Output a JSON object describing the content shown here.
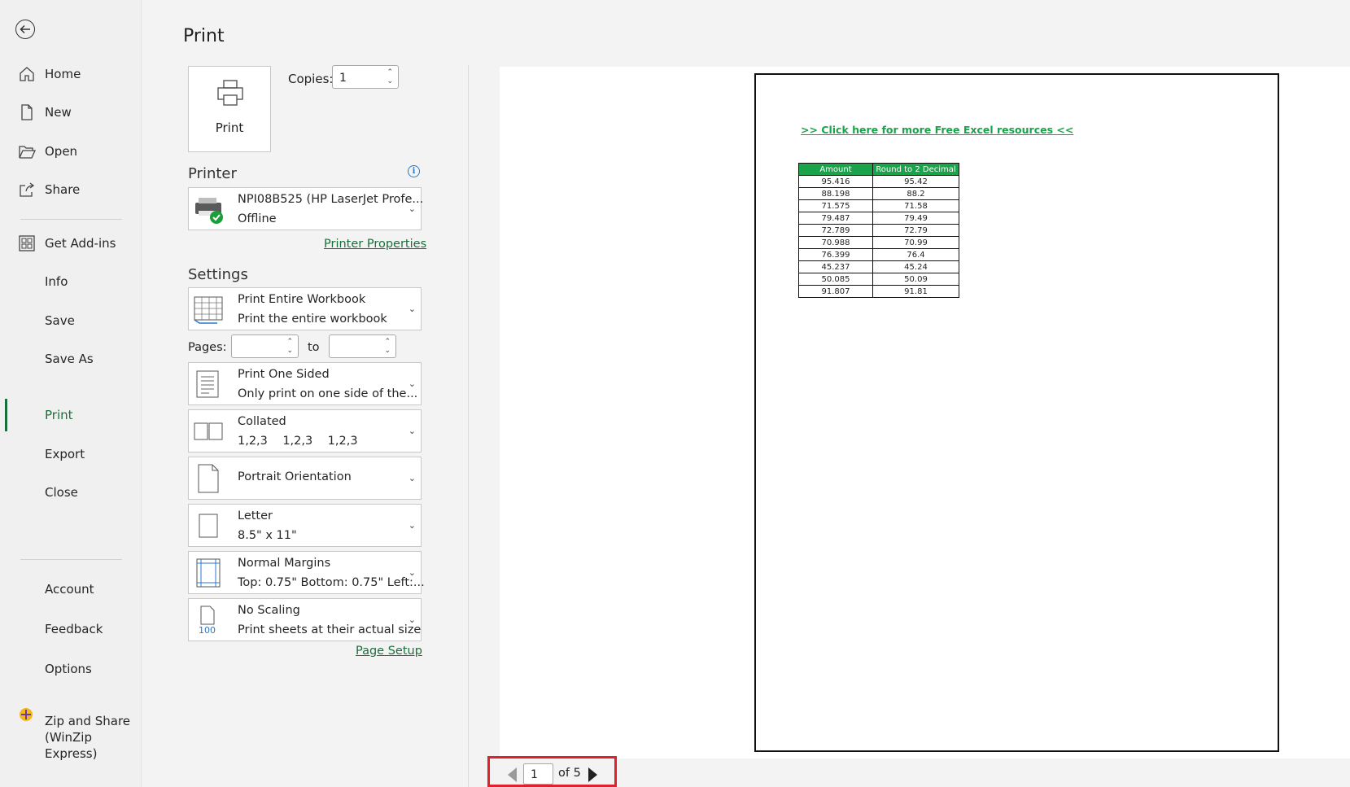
{
  "nav": {
    "items": [
      {
        "label": "Home",
        "icon": "home-icon"
      },
      {
        "label": "New",
        "icon": "new-file-icon"
      },
      {
        "label": "Open",
        "icon": "folder-open-icon"
      },
      {
        "label": "Share",
        "icon": "share-icon"
      },
      {
        "label": "Get Add-ins",
        "icon": "add-ins-grid-icon"
      },
      {
        "label": "Info"
      },
      {
        "label": "Save"
      },
      {
        "label": "Save As"
      },
      {
        "label": "Print",
        "active": true
      },
      {
        "label": "Export"
      },
      {
        "label": "Close"
      },
      {
        "label": "Account"
      },
      {
        "label": "Feedback"
      },
      {
        "label": "Options"
      },
      {
        "label": "Zip and Share (WinZip Express)",
        "icon": "winzip-icon"
      }
    ]
  },
  "print": {
    "title": "Print",
    "print_button": "Print",
    "copies_label": "Copies:",
    "copies_value": "1",
    "printer_heading": "Printer",
    "printer_name": "NPI08B525 (HP LaserJet Profe...",
    "printer_status": "Offline",
    "printer_properties": "Printer Properties",
    "settings_heading": "Settings",
    "what": {
      "line1": "Print Entire Workbook",
      "line2": "Print the entire workbook"
    },
    "pages_label": "Pages:",
    "to_label": "to",
    "sided": {
      "line1": "Print One Sided",
      "line2": "Only print on one side of the..."
    },
    "collate": {
      "line1": "Collated",
      "line2": "1,2,3    1,2,3    1,2,3"
    },
    "orientation": {
      "line1": "Portrait Orientation"
    },
    "paper": {
      "line1": "Letter",
      "line2": "8.5\" x 11\""
    },
    "margins": {
      "line1": "Normal Margins",
      "line2": "Top: 0.75\" Bottom: 0.75\" Left:..."
    },
    "scaling": {
      "line1": "No Scaling",
      "line2": "Print sheets at their actual size",
      "icon_text": "100"
    },
    "page_setup": "Page Setup"
  },
  "preview": {
    "link": ">> Click here for more Free Excel resources <<",
    "headers": [
      "Amount",
      "Round to 2 Decimal"
    ],
    "rows": [
      [
        "95.416",
        "95.42"
      ],
      [
        "88.198",
        "88.2"
      ],
      [
        "71.575",
        "71.58"
      ],
      [
        "79.487",
        "79.49"
      ],
      [
        "72.789",
        "72.79"
      ],
      [
        "70.988",
        "70.99"
      ],
      [
        "76.399",
        "76.4"
      ],
      [
        "45.237",
        "45.24"
      ],
      [
        "50.085",
        "50.09"
      ],
      [
        "91.807",
        "91.81"
      ]
    ],
    "header_color": "#1aa34a"
  },
  "pagenav": {
    "current": "1",
    "of": "of 5"
  }
}
